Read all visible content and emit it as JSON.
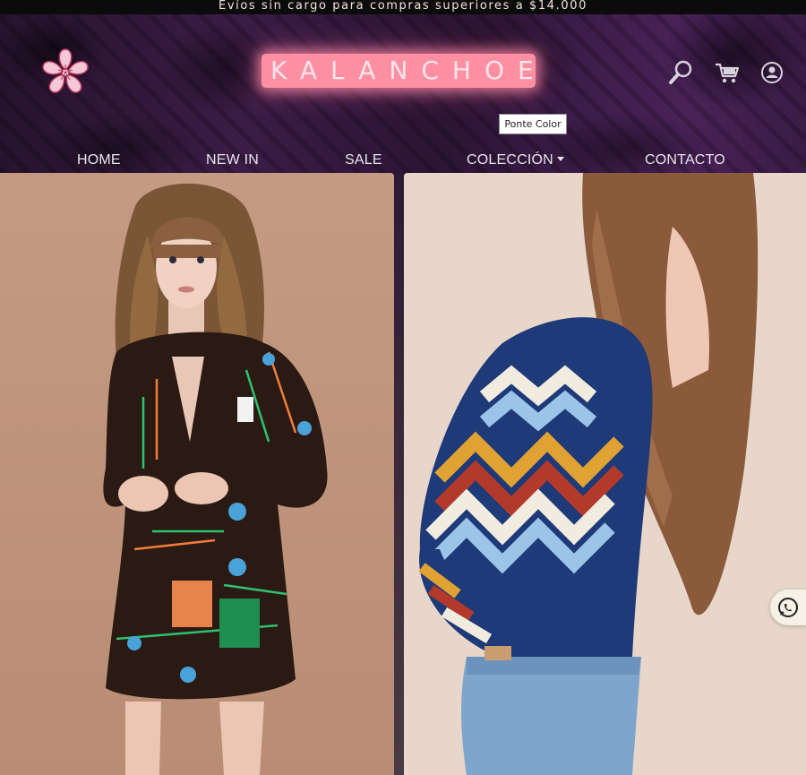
{
  "promo_bar": {
    "text": "Evíos sin cargo para compras superiores a $14.000"
  },
  "header": {
    "brand_name": "KALANCHOE",
    "brand_color": "#ff8fa2",
    "logo_icon": "sakura-flower-icon",
    "icons": [
      "search-icon",
      "cart-icon",
      "user-account-icon"
    ],
    "tooltip": "Ponte Color"
  },
  "nav": {
    "items": [
      {
        "label": "HOME"
      },
      {
        "label": "NEW IN"
      },
      {
        "label": "SALE"
      },
      {
        "label": "COLECCIÓN",
        "has_dropdown": true
      },
      {
        "label": "CONTACTO"
      }
    ]
  },
  "hero": {
    "panels": [
      {
        "image": "model-in-patterned-brown-dress",
        "background": "#c1957c"
      },
      {
        "image": "model-in-chevron-knit-sweater-and-jeans",
        "background": "#e8d7cd"
      }
    ]
  },
  "floating": {
    "icon": "whatsapp-icon"
  }
}
